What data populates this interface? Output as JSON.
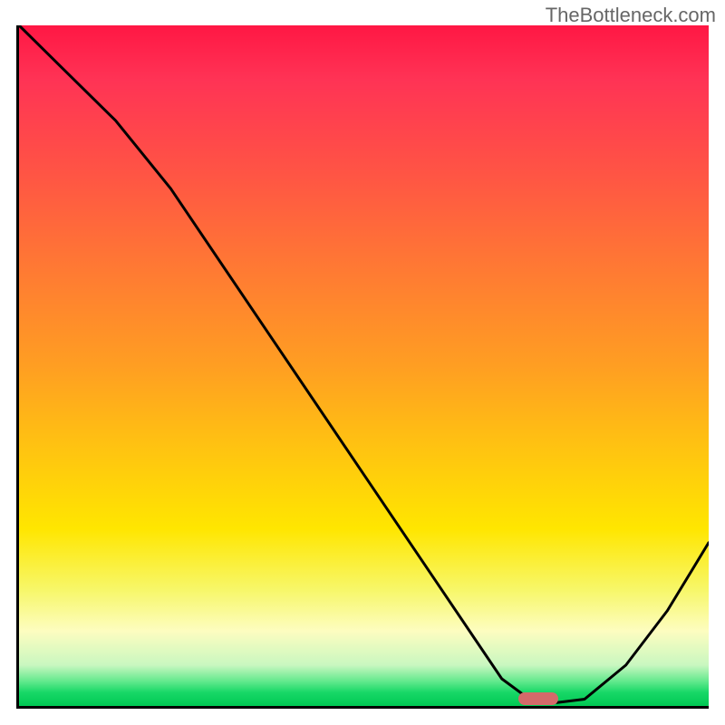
{
  "watermark": "TheBottleneck.com",
  "chart_data": {
    "type": "line",
    "title": "",
    "xlabel": "",
    "ylabel": "",
    "xlim": [
      0,
      100
    ],
    "ylim": [
      0,
      100
    ],
    "grid": false,
    "legend": false,
    "annotations": [],
    "series": [
      {
        "name": "bottleneck-curve",
        "x": [
          0,
          6,
          14,
          22,
          30,
          40,
          50,
          60,
          66,
          70,
          74,
          78,
          82,
          88,
          94,
          100
        ],
        "y": [
          100,
          94,
          86,
          76,
          64,
          49,
          34,
          19,
          10,
          4,
          1,
          0.5,
          1,
          6,
          14,
          24
        ]
      },
      {
        "name": "optimal-marker",
        "x": [
          75
        ],
        "y": [
          1
        ]
      }
    ],
    "gradient_stops": [
      {
        "pos": 0,
        "color": "#ff1744"
      },
      {
        "pos": 0.08,
        "color": "#ff3355"
      },
      {
        "pos": 0.22,
        "color": "#ff5544"
      },
      {
        "pos": 0.36,
        "color": "#ff7a33"
      },
      {
        "pos": 0.5,
        "color": "#ff9e22"
      },
      {
        "pos": 0.62,
        "color": "#ffc311"
      },
      {
        "pos": 0.74,
        "color": "#ffe600"
      },
      {
        "pos": 0.83,
        "color": "#f7f76a"
      },
      {
        "pos": 0.89,
        "color": "#fdfdc0"
      },
      {
        "pos": 0.94,
        "color": "#c9f7c0"
      },
      {
        "pos": 0.965,
        "color": "#5de88a"
      },
      {
        "pos": 0.98,
        "color": "#18d867"
      },
      {
        "pos": 1.0,
        "color": "#00c853"
      }
    ]
  },
  "colors": {
    "axis": "#000000",
    "curve": "#000000",
    "marker": "#d46a6a",
    "watermark": "#666666"
  }
}
